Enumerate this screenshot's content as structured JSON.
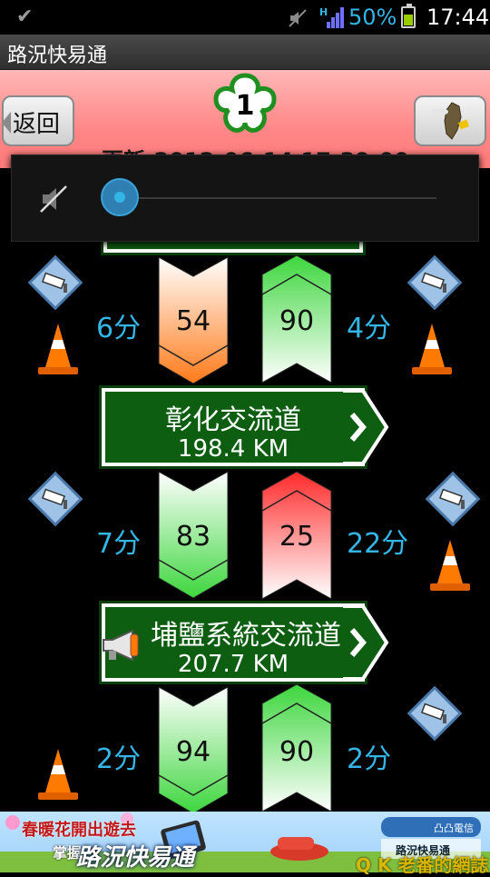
{
  "status_bar": {
    "battery_percent": "50%",
    "time": "17:44",
    "signal_label": "H"
  },
  "app": {
    "title": "路況快易通"
  },
  "header": {
    "back_label": "返回",
    "route_number": "1",
    "update_text": "更新:2012-06-14 17:39:00"
  },
  "volume": {
    "level": 0
  },
  "interchanges": [
    {
      "name": "彰化交流道",
      "km": "198.4 KM"
    },
    {
      "name": "埔鹽系統交流道",
      "km": "207.7 KM"
    }
  ],
  "segments": [
    {
      "left_time": "6分",
      "south_speed": "54",
      "north_speed": "90",
      "right_time": "4分",
      "south_color": "orange",
      "north_color": "green"
    },
    {
      "left_time": "7分",
      "south_speed": "83",
      "north_speed": "25",
      "right_time": "22分",
      "south_color": "green",
      "north_color": "red"
    },
    {
      "left_time": "2分",
      "south_speed": "94",
      "north_speed": "90",
      "right_time": "2分",
      "south_color": "green",
      "north_color": "green"
    }
  ],
  "ad": {
    "line1": "春暖花開出遊去",
    "line2": "掌握",
    "brand": "路況快易通",
    "sponsor": "凸凸電信",
    "watermark": "Q K 老番的網誌"
  },
  "colors": {
    "accent_blue": "#33b5e5",
    "sign_green": "#0e5e12",
    "header_pink": "#ff8787"
  }
}
